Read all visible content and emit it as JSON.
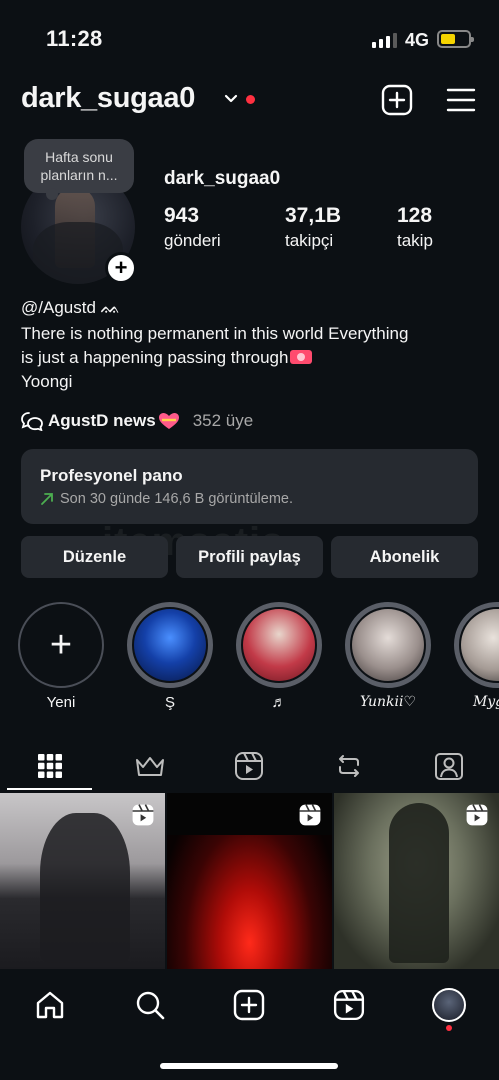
{
  "status_bar": {
    "time": "11:28",
    "network": "4G"
  },
  "header": {
    "username": "dark_sugaa0"
  },
  "note": {
    "text": "Hafta sonu planların n..."
  },
  "profile": {
    "name": "dark_sugaa0",
    "stats": [
      {
        "value": "943",
        "label": "gönderi"
      },
      {
        "value": "37,1B",
        "label": "takipçi"
      },
      {
        "value": "128",
        "label": "takip"
      }
    ],
    "handle": "@/Agustd ",
    "handle_icon": "ᨐ",
    "bio_lines": [
      "There is nothing permanent in this world Everything",
      "is just a happening passing through",
      "Yoongi"
    ]
  },
  "channel": {
    "name": "AgustD news",
    "members": "352 üye"
  },
  "dashboard": {
    "title": "Profesyonel pano",
    "subtitle": "Son 30 günde 146,6 B görüntüleme."
  },
  "actions": [
    "Düzenle",
    "Profili paylaş",
    "Abonelik"
  ],
  "watermark": "itemsatis",
  "highlights": [
    {
      "label": "Yeni"
    },
    {
      "label": "Ş"
    },
    {
      "label": "♬"
    },
    {
      "label": "Yunkii♡"
    },
    {
      "label": "Myg( ˘"
    }
  ],
  "colors": {
    "background": "#0c1014",
    "card": "#262a30",
    "accent_red": "#ff3040",
    "battery": "#f5d400",
    "trend_green": "#4caf50"
  },
  "icons": {
    "tabs": [
      "grid-icon",
      "crown-icon",
      "reels-icon",
      "repost-icon",
      "tagged-icon"
    ],
    "nav": [
      "home-icon",
      "search-icon",
      "create-icon",
      "reels-icon",
      "profile-avatar"
    ]
  }
}
